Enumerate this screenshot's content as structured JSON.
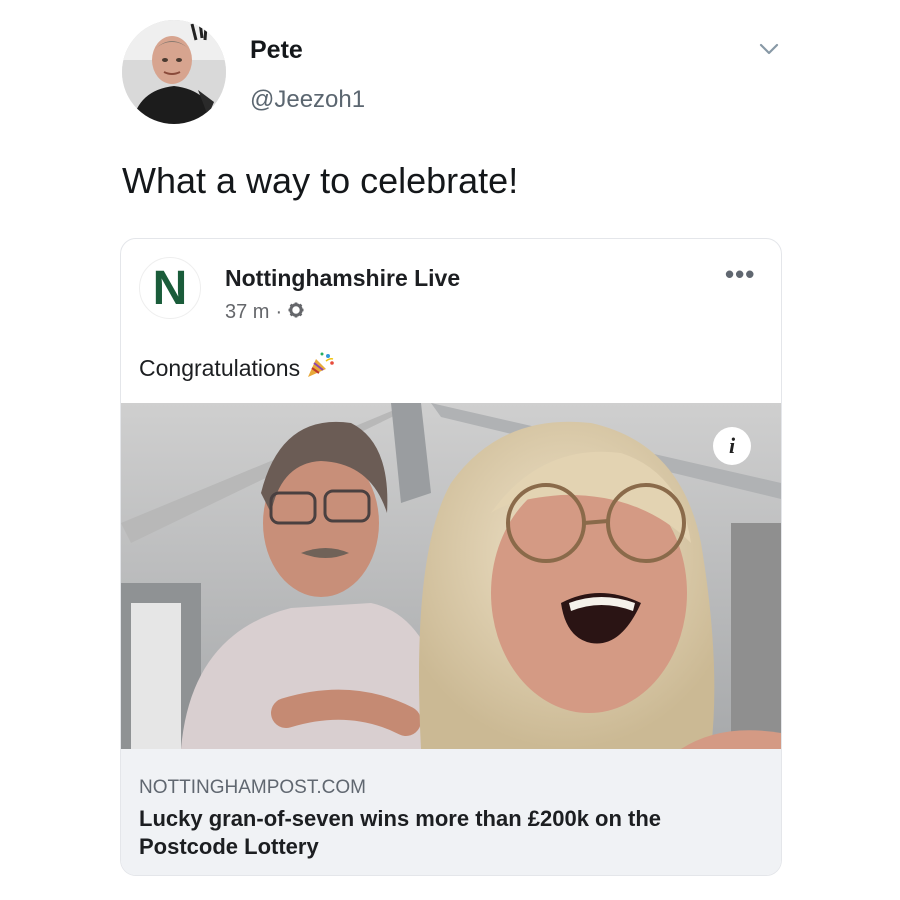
{
  "tweet": {
    "author_name": "Pete",
    "author_handle": "@Jeezoh1",
    "text": "What a way to celebrate!"
  },
  "icons": {
    "menu": "chevron-down-icon",
    "avatar": "avatar",
    "privacy": "gear-icon",
    "emoji": "party-popper-icon",
    "info": "info-icon"
  },
  "embedded_post": {
    "page_logo_letter": "N",
    "page_name": "Nottinghamshire Live",
    "time": "37 m",
    "separator": "·",
    "text": "Congratulations",
    "more_label": "•••",
    "info_label": "i",
    "link": {
      "domain": "NOTTINGHAMPOST.COM",
      "headline": "Lucky gran-of-seven wins more than £200k on the Postcode Lottery"
    }
  },
  "colors": {
    "page_logo": "#1a5c3a",
    "link_background": "#f0f2f5",
    "handle_gray": "#5b6670"
  }
}
